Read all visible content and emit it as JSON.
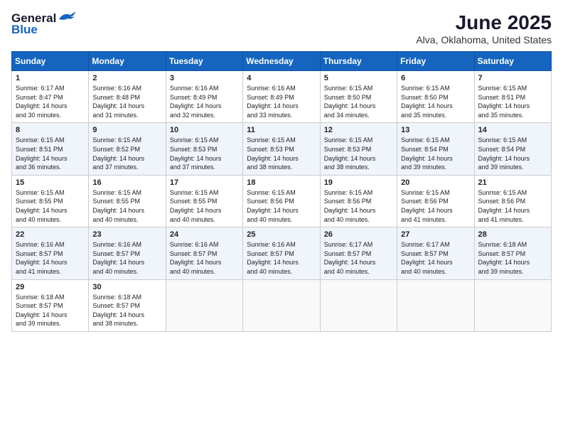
{
  "header": {
    "logo": {
      "general": "General",
      "blue": "Blue"
    },
    "title": "June 2025",
    "location": "Alva, Oklahoma, United States"
  },
  "weekdays": [
    "Sunday",
    "Monday",
    "Tuesday",
    "Wednesday",
    "Thursday",
    "Friday",
    "Saturday"
  ],
  "weeks": [
    [
      {
        "day": 1,
        "info": "Sunrise: 6:17 AM\nSunset: 8:47 PM\nDaylight: 14 hours\nand 30 minutes."
      },
      {
        "day": 2,
        "info": "Sunrise: 6:16 AM\nSunset: 8:48 PM\nDaylight: 14 hours\nand 31 minutes."
      },
      {
        "day": 3,
        "info": "Sunrise: 6:16 AM\nSunset: 8:49 PM\nDaylight: 14 hours\nand 32 minutes."
      },
      {
        "day": 4,
        "info": "Sunrise: 6:16 AM\nSunset: 8:49 PM\nDaylight: 14 hours\nand 33 minutes."
      },
      {
        "day": 5,
        "info": "Sunrise: 6:15 AM\nSunset: 8:50 PM\nDaylight: 14 hours\nand 34 minutes."
      },
      {
        "day": 6,
        "info": "Sunrise: 6:15 AM\nSunset: 8:50 PM\nDaylight: 14 hours\nand 35 minutes."
      },
      {
        "day": 7,
        "info": "Sunrise: 6:15 AM\nSunset: 8:51 PM\nDaylight: 14 hours\nand 35 minutes."
      }
    ],
    [
      {
        "day": 8,
        "info": "Sunrise: 6:15 AM\nSunset: 8:51 PM\nDaylight: 14 hours\nand 36 minutes."
      },
      {
        "day": 9,
        "info": "Sunrise: 6:15 AM\nSunset: 8:52 PM\nDaylight: 14 hours\nand 37 minutes."
      },
      {
        "day": 10,
        "info": "Sunrise: 6:15 AM\nSunset: 8:53 PM\nDaylight: 14 hours\nand 37 minutes."
      },
      {
        "day": 11,
        "info": "Sunrise: 6:15 AM\nSunset: 8:53 PM\nDaylight: 14 hours\nand 38 minutes."
      },
      {
        "day": 12,
        "info": "Sunrise: 6:15 AM\nSunset: 8:53 PM\nDaylight: 14 hours\nand 38 minutes."
      },
      {
        "day": 13,
        "info": "Sunrise: 6:15 AM\nSunset: 8:54 PM\nDaylight: 14 hours\nand 39 minutes."
      },
      {
        "day": 14,
        "info": "Sunrise: 6:15 AM\nSunset: 8:54 PM\nDaylight: 14 hours\nand 39 minutes."
      }
    ],
    [
      {
        "day": 15,
        "info": "Sunrise: 6:15 AM\nSunset: 8:55 PM\nDaylight: 14 hours\nand 40 minutes."
      },
      {
        "day": 16,
        "info": "Sunrise: 6:15 AM\nSunset: 8:55 PM\nDaylight: 14 hours\nand 40 minutes."
      },
      {
        "day": 17,
        "info": "Sunrise: 6:15 AM\nSunset: 8:55 PM\nDaylight: 14 hours\nand 40 minutes."
      },
      {
        "day": 18,
        "info": "Sunrise: 6:15 AM\nSunset: 8:56 PM\nDaylight: 14 hours\nand 40 minutes."
      },
      {
        "day": 19,
        "info": "Sunrise: 6:15 AM\nSunset: 8:56 PM\nDaylight: 14 hours\nand 40 minutes."
      },
      {
        "day": 20,
        "info": "Sunrise: 6:15 AM\nSunset: 8:56 PM\nDaylight: 14 hours\nand 41 minutes."
      },
      {
        "day": 21,
        "info": "Sunrise: 6:15 AM\nSunset: 8:56 PM\nDaylight: 14 hours\nand 41 minutes."
      }
    ],
    [
      {
        "day": 22,
        "info": "Sunrise: 6:16 AM\nSunset: 8:57 PM\nDaylight: 14 hours\nand 41 minutes."
      },
      {
        "day": 23,
        "info": "Sunrise: 6:16 AM\nSunset: 8:57 PM\nDaylight: 14 hours\nand 40 minutes."
      },
      {
        "day": 24,
        "info": "Sunrise: 6:16 AM\nSunset: 8:57 PM\nDaylight: 14 hours\nand 40 minutes."
      },
      {
        "day": 25,
        "info": "Sunrise: 6:16 AM\nSunset: 8:57 PM\nDaylight: 14 hours\nand 40 minutes."
      },
      {
        "day": 26,
        "info": "Sunrise: 6:17 AM\nSunset: 8:57 PM\nDaylight: 14 hours\nand 40 minutes."
      },
      {
        "day": 27,
        "info": "Sunrise: 6:17 AM\nSunset: 8:57 PM\nDaylight: 14 hours\nand 40 minutes."
      },
      {
        "day": 28,
        "info": "Sunrise: 6:18 AM\nSunset: 8:57 PM\nDaylight: 14 hours\nand 39 minutes."
      }
    ],
    [
      {
        "day": 29,
        "info": "Sunrise: 6:18 AM\nSunset: 8:57 PM\nDaylight: 14 hours\nand 39 minutes."
      },
      {
        "day": 30,
        "info": "Sunrise: 6:18 AM\nSunset: 8:57 PM\nDaylight: 14 hours\nand 38 minutes."
      },
      null,
      null,
      null,
      null,
      null
    ]
  ]
}
